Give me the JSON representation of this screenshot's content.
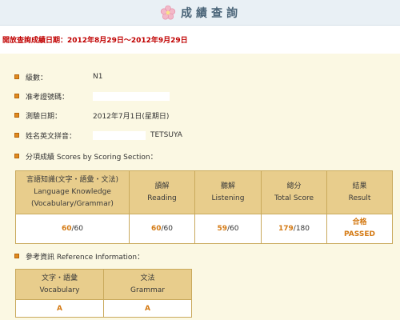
{
  "header": {
    "title": "成績查詢"
  },
  "period_text": "開放查詢成績日期：2012年8月29日～2012年9月29日",
  "info": {
    "level_label": "級數：",
    "level_value": "N1",
    "admission_label": "准考證號碼：",
    "test_date_label": "測驗日期：",
    "test_date_value": "2012年7月1日(星期日)",
    "name_label": "姓名英文拼音：",
    "name_value": "TETSUYA"
  },
  "scores_section": {
    "heading": "分項成績 Scores by Scoring Section：",
    "columns": [
      {
        "line1": "言語知識(文字・語彙・文法)",
        "line2": "Language Knowledge",
        "line3": "(Vocabulary/Grammar)"
      },
      {
        "line1": "讀解",
        "line2": "Reading"
      },
      {
        "line1": "聽解",
        "line2": "Listening"
      },
      {
        "line1": "總分",
        "line2": "Total Score"
      },
      {
        "line1": "結果",
        "line2": "Result"
      }
    ],
    "values": [
      {
        "score": "60",
        "max": "/60"
      },
      {
        "score": "60",
        "max": "/60"
      },
      {
        "score": "59",
        "max": "/60"
      },
      {
        "score": "179",
        "max": "/180"
      }
    ],
    "result_zh": "合格",
    "result_en": "PASSED"
  },
  "reference_section": {
    "heading": "參考資訊 Reference Information：",
    "columns": [
      {
        "line1": "文字・語彙",
        "line2": "Vocabulary"
      },
      {
        "line1": "文法",
        "line2": "Grammar"
      }
    ],
    "grades": [
      "A",
      "A"
    ]
  },
  "colors": {
    "accent": "#d47a14",
    "period": "#c00000",
    "panel_bg": "#fbf8e3",
    "table_header": "#e8cd8c"
  }
}
